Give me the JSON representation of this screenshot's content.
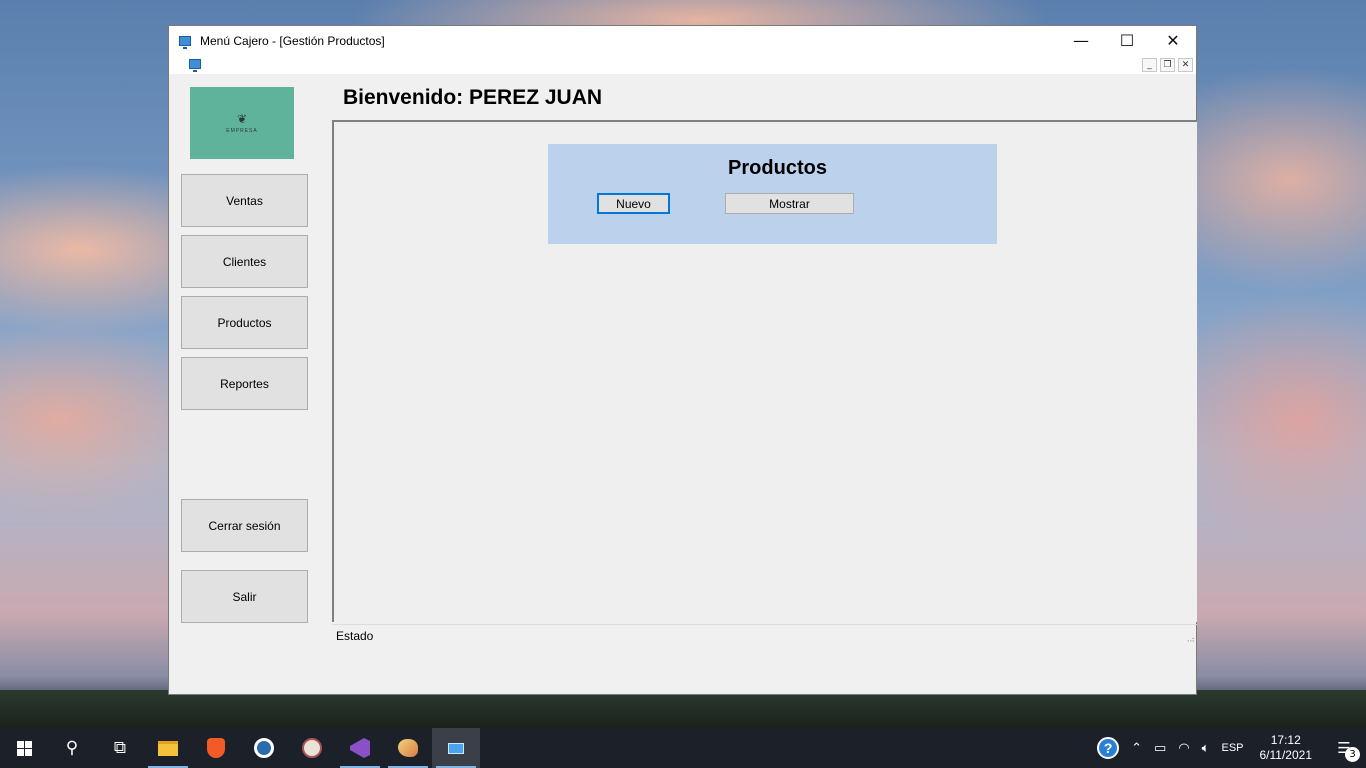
{
  "window": {
    "title": "Menú Cajero - [Gestión Productos]",
    "minimize_glyph": "—",
    "maximize_glyph": "☐",
    "close_glyph": "✕"
  },
  "mdi_controls": {
    "minimize": "_",
    "restore": "❐",
    "close": "✕"
  },
  "logo": {
    "text": "EMPRESA",
    "mark": "❦"
  },
  "nav": {
    "ventas": "Ventas",
    "clientes": "Clientes",
    "productos": "Productos",
    "reportes": "Reportes",
    "cerrar_sesion": "Cerrar sesión",
    "salir": "Salir"
  },
  "welcome": "Bienvenido: PEREZ JUAN",
  "products_panel": {
    "title": "Productos",
    "new_button": "Nuevo",
    "show_button": "Mostrar"
  },
  "status": {
    "text": "Estado"
  },
  "taskbar": {
    "search_glyph": "⚲",
    "task_view_glyph": "⧉",
    "language": "ESP",
    "time": "17:12",
    "date": "6/11/2021",
    "notification_count": "3",
    "help_glyph": "?"
  },
  "colors": {
    "logo_bg": "#5fb39a",
    "panel_bg": "#bcd2ec",
    "focus_border": "#0078d7",
    "taskbar_bg": "#1c2029"
  }
}
